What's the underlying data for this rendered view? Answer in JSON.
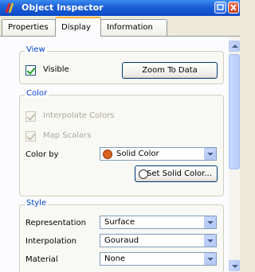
{
  "window": {
    "title": "Object Inspector"
  },
  "tabs": [
    {
      "label": "Properties"
    },
    {
      "label": "Display"
    },
    {
      "label": "Information"
    }
  ],
  "view": {
    "title": "View",
    "visible_label": "Visible",
    "visible_checked": true,
    "zoom_button": "Zoom To Data"
  },
  "color": {
    "title": "Color",
    "interpolate_label": "Interpolate Colors",
    "map_scalars_label": "Map Scalars",
    "color_by_label": "Color by",
    "color_by_value": "Solid Color",
    "solid_color_swatch": "#d9631f",
    "set_solid_color_button": "Set Solid Color..."
  },
  "style": {
    "title": "Style",
    "representation_label": "Representation",
    "representation_value": "Surface",
    "interpolation_label": "Interpolation",
    "interpolation_value": "Gouraud",
    "material_label": "Material",
    "material_value": "None"
  }
}
